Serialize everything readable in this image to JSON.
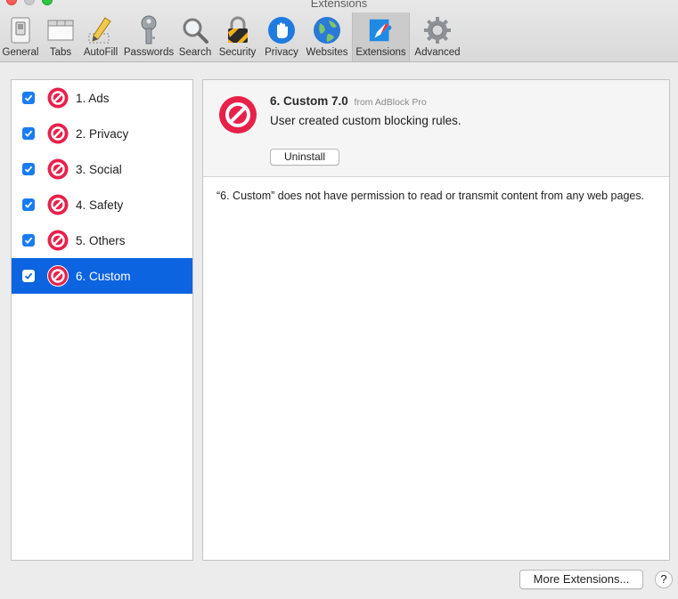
{
  "window": {
    "title": "Extensions"
  },
  "toolbar": {
    "tabs": [
      {
        "label": "General",
        "icon": "switch-icon"
      },
      {
        "label": "Tabs",
        "icon": "tabs-icon"
      },
      {
        "label": "AutoFill",
        "icon": "pencil-icon"
      },
      {
        "label": "Passwords",
        "icon": "key-icon"
      },
      {
        "label": "Search",
        "icon": "magnifier-icon"
      },
      {
        "label": "Security",
        "icon": "lock-icon"
      },
      {
        "label": "Privacy",
        "icon": "hand-icon"
      },
      {
        "label": "Websites",
        "icon": "globe-icon"
      },
      {
        "label": "Extensions",
        "icon": "puzzle-icon",
        "active": true
      },
      {
        "label": "Advanced",
        "icon": "gear-icon"
      }
    ]
  },
  "extensions": [
    {
      "name": "1. Ads",
      "enabled": true
    },
    {
      "name": "2. Privacy",
      "enabled": true
    },
    {
      "name": "3. Social",
      "enabled": true
    },
    {
      "name": "4. Safety",
      "enabled": true
    },
    {
      "name": "5. Others",
      "enabled": true
    },
    {
      "name": "6. Custom",
      "enabled": true,
      "selected": true
    }
  ],
  "detail": {
    "title": "6. Custom 7.0",
    "from": "from AdBlock Pro",
    "description": "User created custom blocking rules.",
    "uninstall_label": "Uninstall",
    "permission_text": "“6. Custom” does not have permission to read or transmit content from any web pages."
  },
  "footer": {
    "more_extensions_label": "More Extensions...",
    "help_label": "?"
  },
  "colors": {
    "selection": "#0d64e1",
    "checkbox": "#1a7cf5",
    "badge_red": "#e8214a"
  }
}
